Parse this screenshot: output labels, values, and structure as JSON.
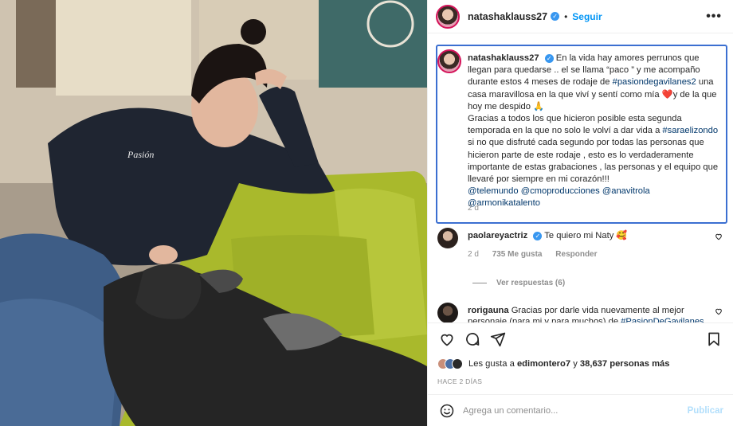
{
  "post": {
    "username": "natashaklauss27",
    "follow_label": "Seguir",
    "dot": "•",
    "more_label": "•••",
    "verified_mark": "✓",
    "caption": {
      "username": "natashaklauss27",
      "p1_a": "En la vida hay amores perrunos que llegan para quedarse .. el se llama “paco ” y me acompaño durante estos 4 meses de rodaje de ",
      "p1_tag": "#pasiondegavilanes2",
      "p1_b": " una casa maravillosa en la que viví y sentí como mía ",
      "p1_heart": "❤️",
      "p1_c": "y de la que hoy me despido ",
      "p1_emoji": "🙏",
      "p2_a": "Gracias a todos los que hicieron posible esta segunda temporada en la que no solo le volví a dar vida a ",
      "p2_tag": "#saraelizondo",
      "p2_b": " si no que disfruté cada segundo por todas las personas que hicieron parte de este rodaje , esto es lo verdaderamente importante de estas grabaciones , las personas y el equipo que llevaré por siempre en mi corazón!!!",
      "mentions": [
        "@telemundo",
        "@cmoproducciones",
        "@anavitrola",
        "@armonikatalento"
      ],
      "age": "2 d"
    },
    "comments": [
      {
        "username": "paolareyactriz",
        "text": "Te quiero mi Naty ",
        "emoji": "🥰",
        "age": "2 d",
        "likes": "735 Me gusta",
        "reply": "Responder"
      },
      {
        "username": "rorigauna",
        "text": "Gracias por darle vida nuevamente al mejor personaje (para mi y para muchos) de ",
        "tag": "#PasionDeGavilanes"
      }
    ],
    "view_replies": "Ver respuestas (6)",
    "likes": {
      "prefix": "Les gusta a ",
      "first": "edimontero7",
      "middle": " y ",
      "count": "38,637 personas más"
    },
    "time": "HACE 2 DÍAS",
    "comment_placeholder": "Agrega un comentario...",
    "publish_label": "Publicar"
  },
  "icons": [
    "heart-icon",
    "comment-icon",
    "share-icon",
    "bookmark-icon",
    "emoji-icon",
    "verified-icon",
    "small-heart-icon"
  ],
  "colors": {
    "accent": "#0095f6",
    "tag": "#00376b",
    "highlight_border": "#3b6fd1"
  }
}
